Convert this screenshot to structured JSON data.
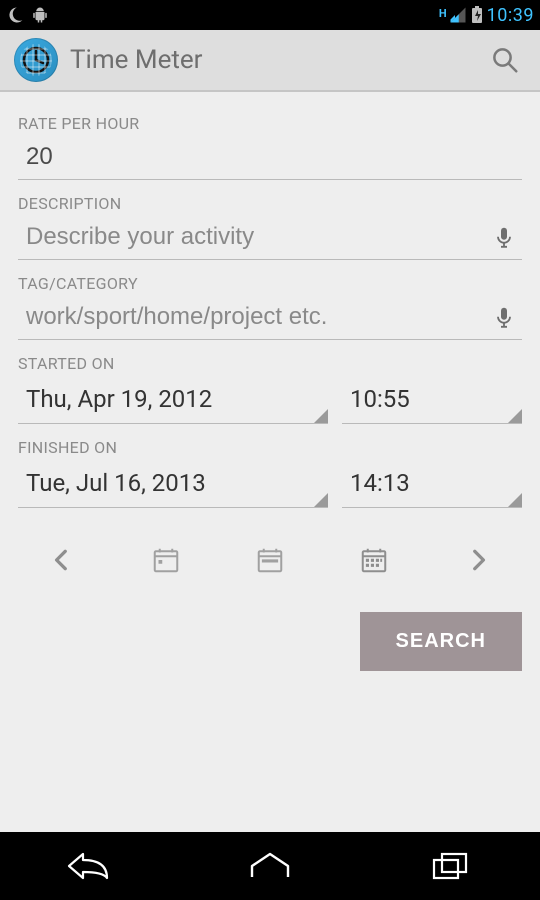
{
  "status": {
    "time": "10:39",
    "indicator": "H"
  },
  "header": {
    "title": "Time Meter"
  },
  "fields": {
    "rate": {
      "label": "RATE PER HOUR",
      "value": "20"
    },
    "description": {
      "label": "DESCRIPTION",
      "placeholder": "Describe your activity",
      "value": ""
    },
    "tag": {
      "label": "TAG/CATEGORY",
      "placeholder": "work/sport/home/project etc.",
      "value": ""
    },
    "started": {
      "label": "STARTED ON",
      "date": "Thu, Apr 19, 2012",
      "time": "10:55"
    },
    "finished": {
      "label": "FINISHED ON",
      "date": "Tue, Jul 16, 2013",
      "time": "14:13"
    }
  },
  "buttons": {
    "search": "SEARCH"
  }
}
